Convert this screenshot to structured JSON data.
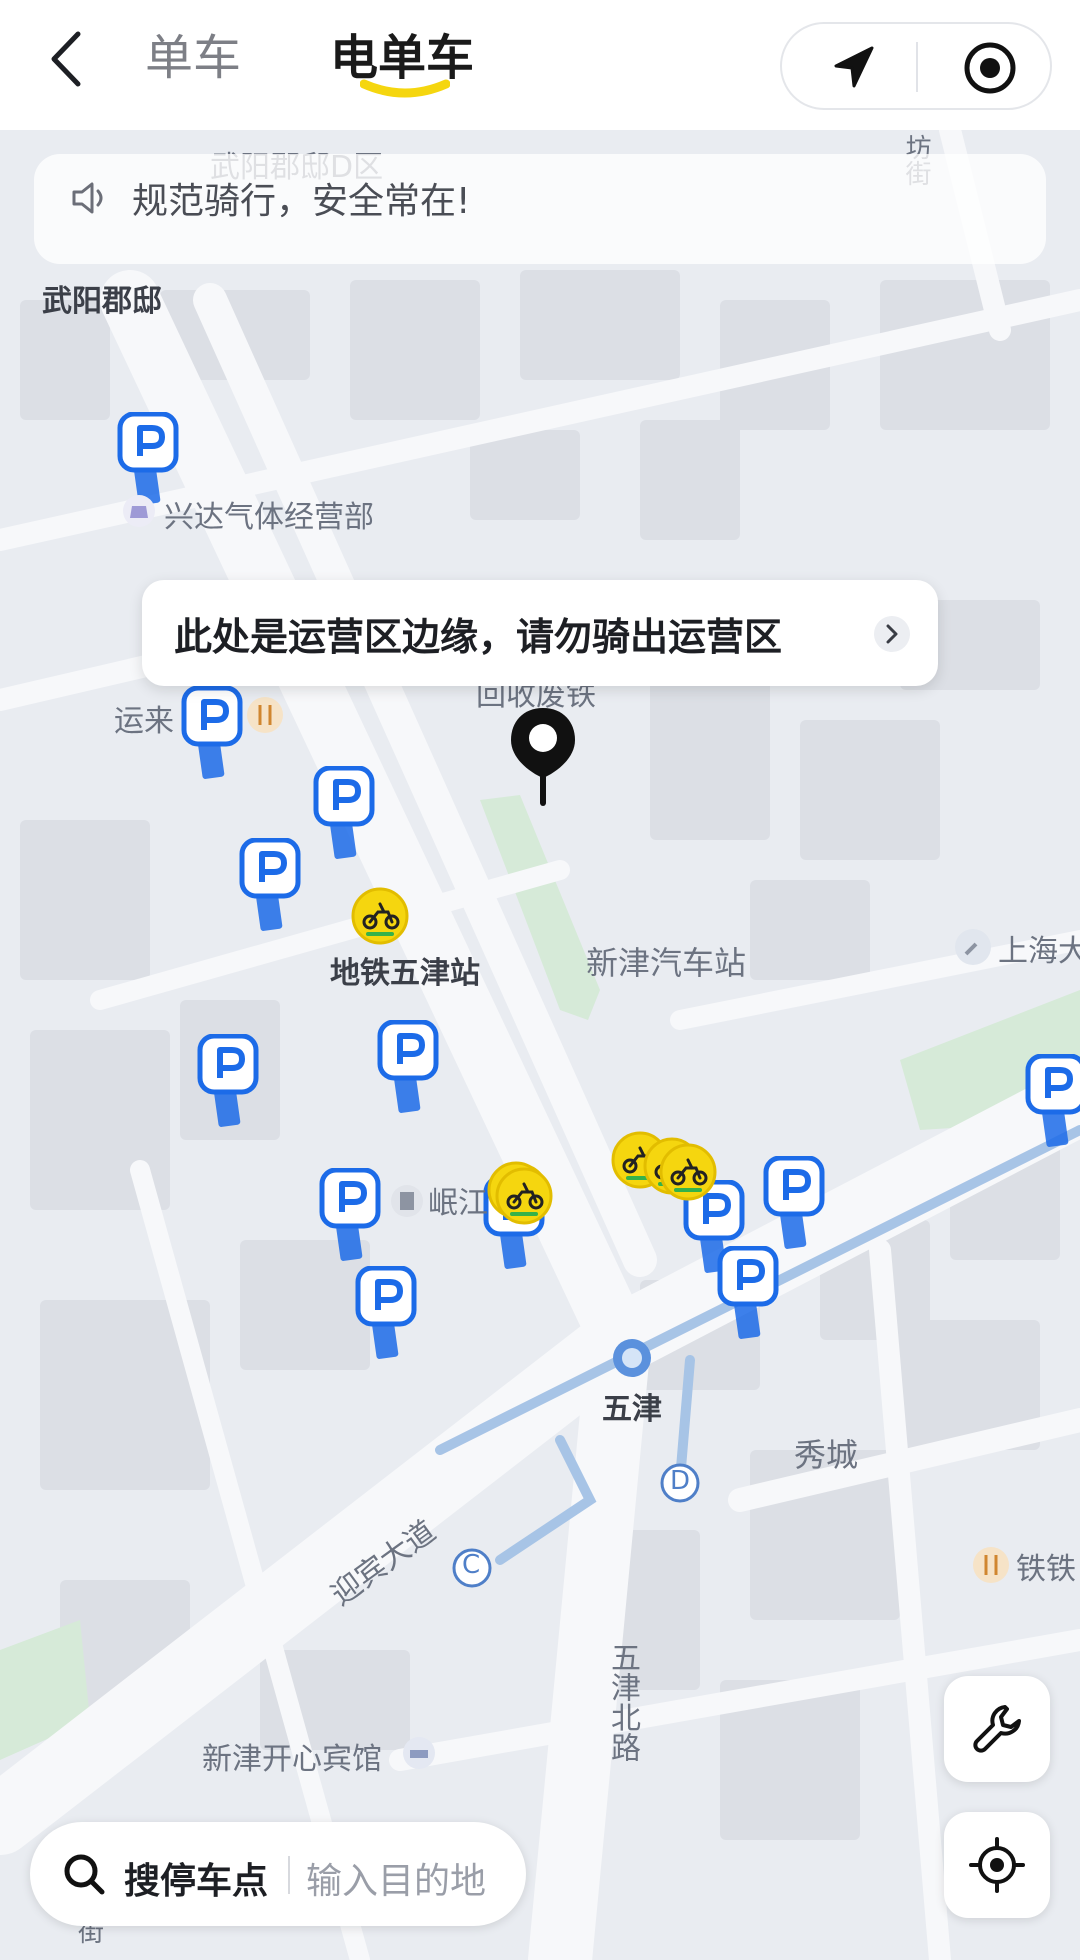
{
  "header": {
    "tabs": [
      {
        "label": "单车",
        "active": false
      },
      {
        "label": "电单车",
        "active": true
      }
    ],
    "accent_color": "#f5d60f"
  },
  "notice": {
    "text": "规范骑行，安全常在!"
  },
  "map": {
    "labels": {
      "wuyang_top": "武阳郡邸D区",
      "wuyang": "武阳郡邸",
      "xingda": "兴达气体经营部",
      "yunlai": "运来",
      "huishou": "回收废铁",
      "metro_station": "地铁五津站",
      "bus_station": "新津汽车站",
      "shanghai": "上海大",
      "minjiang": "岷江",
      "wujin": "五津",
      "xiucheng": "秀城",
      "yingbin": "迎宾大道",
      "wujin_north": "五津北路",
      "hotel": "新津开心宾馆",
      "tie": "铁铁",
      "fang": "坊街",
      "jie": "街"
    },
    "edge_tooltip": "此处是运营区边缘，请勿骑出运营区",
    "exits": [
      "C",
      "D"
    ]
  },
  "search": {
    "label": "搜停车点",
    "placeholder": "输入目的地"
  },
  "colors": {
    "parking_blue": "#1c6be8",
    "bike_yellow": "#f5d60f",
    "map_bg": "#e9ecf1",
    "road": "#f7f8fa"
  }
}
